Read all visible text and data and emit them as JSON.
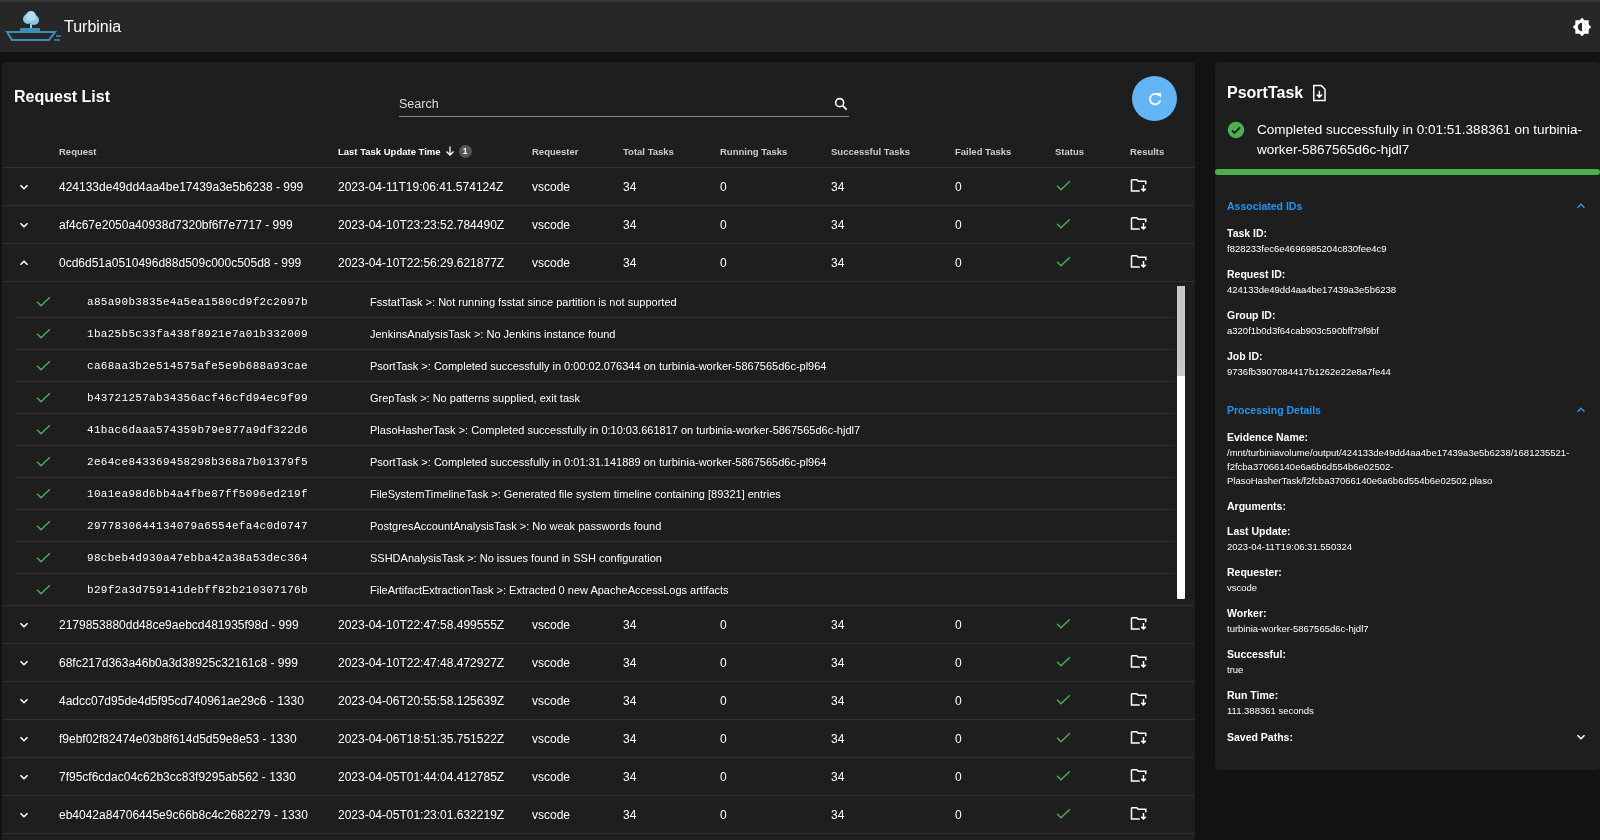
{
  "app": {
    "title": "Turbinia"
  },
  "request_list": {
    "title": "Request List",
    "search": {
      "placeholder": "Search"
    },
    "columns": [
      {
        "label": "Request",
        "sorted": false
      },
      {
        "label": "Last Task Update Time",
        "sorted": true,
        "sort_badge": "1"
      },
      {
        "label": "Requester",
        "sorted": false
      },
      {
        "label": "Total Tasks",
        "sorted": false
      },
      {
        "label": "Running Tasks",
        "sorted": false
      },
      {
        "label": "Successful Tasks",
        "sorted": false
      },
      {
        "label": "Failed Tasks",
        "sorted": false
      },
      {
        "label": "Status",
        "sorted": false
      },
      {
        "label": "Results",
        "sorted": false
      }
    ],
    "rows": [
      {
        "request": "424133de49dd4aa4be17439a3e5b6238 - 999",
        "last_update": "2023-04-11T19:06:41.574124Z",
        "requester": "vscode",
        "total": "34",
        "running": "0",
        "successful": "34",
        "failed": "0",
        "succeeded": true,
        "expanded": false
      },
      {
        "request": "af4c67e2050a40938d7320bf6f7e7717 - 999",
        "last_update": "2023-04-10T23:23:52.784490Z",
        "requester": "vscode",
        "total": "34",
        "running": "0",
        "successful": "34",
        "failed": "0",
        "succeeded": true,
        "expanded": false
      },
      {
        "request": "0cd6d51a0510496d88d509c000c505d8 - 999",
        "last_update": "2023-04-10T22:56:29.621877Z",
        "requester": "vscode",
        "total": "34",
        "running": "0",
        "successful": "34",
        "failed": "0",
        "succeeded": true,
        "expanded": true,
        "tasks": [
          {
            "succeeded": true,
            "id": "a85a90b3835e4a5ea1580cd9f2c2097b",
            "message": "FsstatTask >: Not running fsstat since partition is not supported"
          },
          {
            "succeeded": true,
            "id": "1ba25b5c33fa438f8921e7a01b332009",
            "message": "JenkinsAnalysisTask >: No Jenkins instance found"
          },
          {
            "succeeded": true,
            "id": "ca68aa3b2e514575afe5e9b688a93cae",
            "message": "PsortTask >: Completed successfully in 0:00:02.076344 on turbinia-worker-5867565d6c-pl964"
          },
          {
            "succeeded": true,
            "id": "b43721257ab34356acf46cfd94ec9f99",
            "message": "GrepTask >: No patterns supplied, exit task"
          },
          {
            "succeeded": true,
            "id": "41bac6daaa574359b79e877a9df322d6",
            "message": "PlasoHasherTask >: Completed successfully in 0:10:03.661817 on turbinia-worker-5867565d6c-hjdl7"
          },
          {
            "succeeded": true,
            "id": "2e64ce843369458298b368a7b01379f5",
            "message": "PsortTask >: Completed successfully in 0:01:31.141889 on turbinia-worker-5867565d6c-pl964"
          },
          {
            "succeeded": true,
            "id": "10a1ea98d6bb4a4fbe87ff5096ed219f",
            "message": "FileSystemTimelineTask >: Generated file system timeline containing [89321] entries"
          },
          {
            "succeeded": true,
            "id": "2977830644134079a6554efa4c0d0747",
            "message": "PostgresAccountAnalysisTask >: No weak passwords found"
          },
          {
            "succeeded": true,
            "id": "98cbeb4d930a47ebba42a38a53dec364",
            "message": "SSHDAnalysisTask >: No issues found in SSH configuration"
          },
          {
            "succeeded": true,
            "id": "b29f2a3d759141debff82b210307176b",
            "message": "FileArtifactExtractionTask >: Extracted 0 new ApacheAccessLogs artifacts"
          }
        ]
      },
      {
        "request": "2179853880dd48ce9aebcd481935f98d - 999",
        "last_update": "2023-04-10T22:47:58.499555Z",
        "requester": "vscode",
        "total": "34",
        "running": "0",
        "successful": "34",
        "failed": "0",
        "succeeded": true,
        "expanded": false
      },
      {
        "request": "68fc217d363a46b0a3d38925c32161c8 - 999",
        "last_update": "2023-04-10T22:47:48.472927Z",
        "requester": "vscode",
        "total": "34",
        "running": "0",
        "successful": "34",
        "failed": "0",
        "succeeded": true,
        "expanded": false
      },
      {
        "request": "4adcc07d95de4d5f95cd740961ae29c6 - 1330",
        "last_update": "2023-04-06T20:55:58.125639Z",
        "requester": "vscode",
        "total": "34",
        "running": "0",
        "successful": "34",
        "failed": "0",
        "succeeded": true,
        "expanded": false
      },
      {
        "request": "f9ebf02f82474e03b8f614d5d59e8e53 - 1330",
        "last_update": "2023-04-06T18:51:35.751522Z",
        "requester": "vscode",
        "total": "34",
        "running": "0",
        "successful": "34",
        "failed": "0",
        "succeeded": true,
        "expanded": false
      },
      {
        "request": "7f95cf6cdac04c62b3cc83f9295ab562 - 1330",
        "last_update": "2023-04-05T01:44:04.412785Z",
        "requester": "vscode",
        "total": "34",
        "running": "0",
        "successful": "34",
        "failed": "0",
        "succeeded": true,
        "expanded": false
      },
      {
        "request": "eb4042a84706445e9c66b8c4c2682279 - 1330",
        "last_update": "2023-04-05T01:23:01.632219Z",
        "requester": "vscode",
        "total": "34",
        "running": "0",
        "successful": "34",
        "failed": "0",
        "succeeded": true,
        "expanded": false
      }
    ]
  },
  "task_details": {
    "title": "PsortTask",
    "succeeded": true,
    "status_message": "Completed successfully in 0:01:51.388361 on turbinia-worker-5867565d6c-hjdl7",
    "progress": {
      "level": 1
    },
    "sections": [
      {
        "title": "Associated IDs",
        "expanded": true,
        "fields": [
          {
            "label": "Task ID:",
            "value": "f828233fec6e4696985204c830fee4c9"
          },
          {
            "label": "Request ID:",
            "value": "424133de49dd4aa4be17439a3e5b6238"
          },
          {
            "label": "Group ID:",
            "value": "a320f1b0d3f64cab903c590bff79f9bf"
          },
          {
            "label": "Job ID:",
            "value": "9736fb3907084417b1262e22e8a7fe44"
          }
        ]
      },
      {
        "title": "Processing Details",
        "expanded": true,
        "fields": [
          {
            "label": "Evidence Name:",
            "value": "/mnt/turbiniavolume/output/424133de49dd4aa4be17439a3e5b6238/1681235521-f2fcba37066140e6a6b6d554b6e02502-PlasoHasherTask/f2fcba37066140e6a6b6d554b6e02502.plaso"
          },
          {
            "label": "Arguments:"
          },
          {
            "label": "Last Update:",
            "value": "2023-04-11T19:06:31.550324"
          },
          {
            "label": "Requester:",
            "value": "vscode"
          },
          {
            "label": "Worker:",
            "value": "turbinia-worker-5867565d6c-hjdl7"
          },
          {
            "label": "Successful:",
            "value": "true"
          },
          {
            "label": "Run Time:",
            "value": "111.388361 seconds"
          },
          {
            "label": "Saved Paths:",
            "kind": "expander",
            "expanded": false
          }
        ]
      }
    ]
  }
}
